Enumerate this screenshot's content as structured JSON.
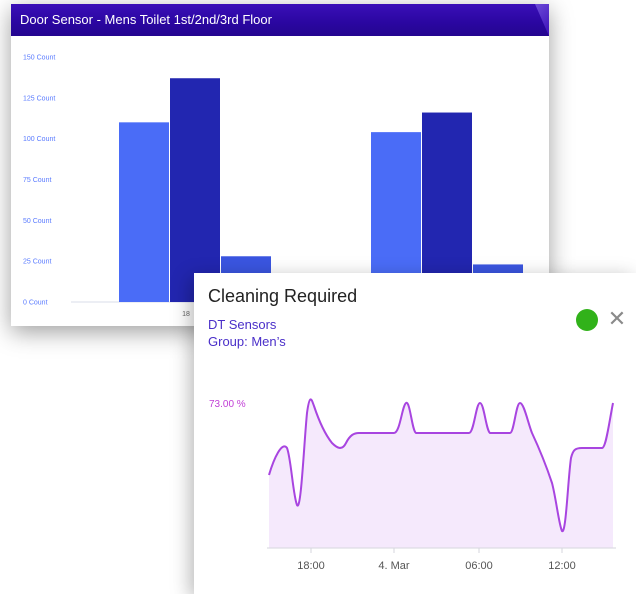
{
  "door_sensor": {
    "title": "Door Sensor - Mens Toilet 1st/2nd/3rd Floor"
  },
  "cleaning": {
    "title": "Cleaning Required",
    "sensor_line": "DT Sensors",
    "group_line": "Group: Men’s",
    "value_label": "73.00 %",
    "status_color": "#31b21a",
    "close_symbol": "✕"
  },
  "chart_data": [
    {
      "type": "bar",
      "title": "Door Sensor - Mens Toilet 1st/2nd/3rd Floor",
      "ylim": [
        0,
        150
      ],
      "yticks": [
        "0 Count",
        "25 Count",
        "50 Count",
        "75 Count",
        "100 Count",
        "125 Count",
        "150 Count"
      ],
      "categories": [
        "18",
        ""
      ],
      "series": [
        {
          "color": "#4a6cf7",
          "values": [
            110,
            104
          ]
        },
        {
          "color": "#2226b0",
          "values": [
            137,
            116
          ]
        },
        {
          "color": "#3a55e0",
          "values": [
            28,
            23
          ]
        }
      ]
    },
    {
      "type": "area",
      "title": "Cleaning Required",
      "xticks": [
        "18:00",
        "4. Mar",
        "06:00",
        "12:00"
      ],
      "annotation": "73.00 %",
      "color": "#a845e0",
      "fill": "#f5e9fc"
    }
  ]
}
